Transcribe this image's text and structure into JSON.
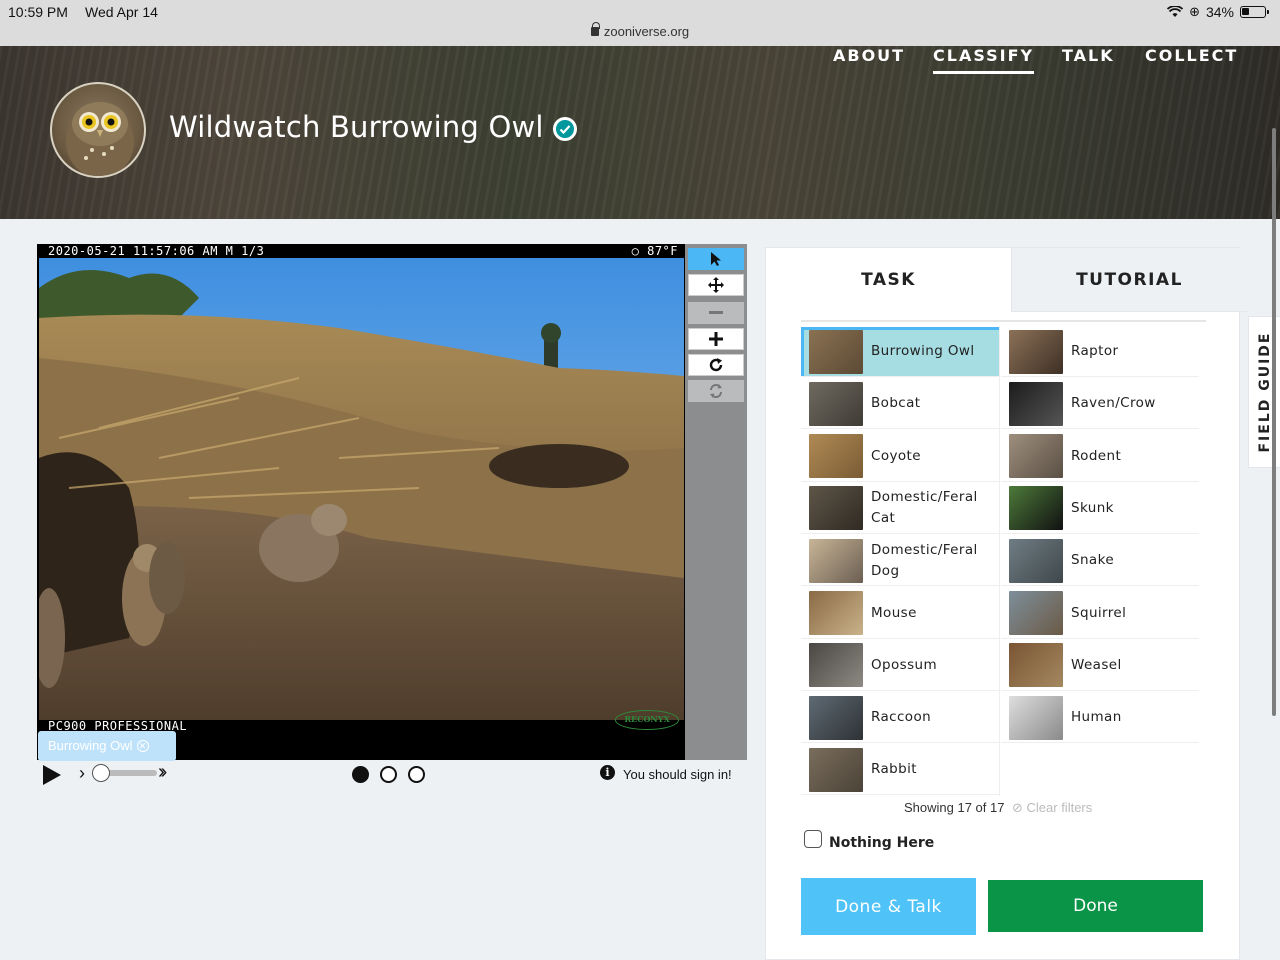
{
  "status_bar": {
    "time": "10:59 PM",
    "date": "Wed Apr 14",
    "url": "zooniverse.org",
    "battery": "34%",
    "battery_fraction": 0.34
  },
  "header": {
    "project_title": "Wildwatch Burrowing Owl",
    "nav": [
      {
        "label": "ABOUT",
        "active": false
      },
      {
        "label": "CLASSIFY",
        "active": true
      },
      {
        "label": "TALK",
        "active": false
      },
      {
        "label": "COLLECT",
        "active": false
      }
    ]
  },
  "viewer": {
    "overlay_top_left": "2020-05-21 11:57:06 AM  M 1/3",
    "overlay_top_right": "○  87°F",
    "overlay_bottom": "PC900 PROFESSIONAL",
    "camera_brand": "RECONYX",
    "annotation_tag": "Burrowing Owl",
    "tools": [
      {
        "name": "pointer-icon",
        "state": "active"
      },
      {
        "name": "move-icon",
        "state": "normal"
      },
      {
        "name": "zoom-out-icon",
        "state": "disabled"
      },
      {
        "name": "zoom-in-icon",
        "state": "normal"
      },
      {
        "name": "rotate-icon",
        "state": "normal"
      },
      {
        "name": "reset-icon",
        "state": "disabled"
      }
    ],
    "frames": [
      true,
      false,
      false
    ],
    "sign_in_message": "You should sign in!"
  },
  "task_panel": {
    "tabs": {
      "task": "TASK",
      "tutorial": "TUTORIAL"
    },
    "choices_left": [
      {
        "label": "Burrowing Owl",
        "selected": true,
        "colors": [
          "#8a7152",
          "#5c4a35"
        ]
      },
      {
        "label": "Bobcat",
        "selected": false,
        "colors": [
          "#6f6a60",
          "#3f3b35"
        ]
      },
      {
        "label": "Coyote",
        "selected": false,
        "colors": [
          "#b08a55",
          "#7a5c34"
        ]
      },
      {
        "label": "Domestic/Feral Cat",
        "selected": false,
        "colors": [
          "#5f5648",
          "#2f2a23"
        ]
      },
      {
        "label": "Domestic/Feral Dog",
        "selected": false,
        "colors": [
          "#c8b597",
          "#6b5f52"
        ]
      },
      {
        "label": "Mouse",
        "selected": false,
        "colors": [
          "#8a6a45",
          "#c9b28a"
        ]
      },
      {
        "label": "Opossum",
        "selected": false,
        "colors": [
          "#4a4742",
          "#8d8a84"
        ]
      },
      {
        "label": "Raccoon",
        "selected": false,
        "colors": [
          "#5f6a73",
          "#2e3236"
        ]
      },
      {
        "label": "Rabbit",
        "selected": false,
        "colors": [
          "#7a6d5c",
          "#4b4338"
        ]
      }
    ],
    "choices_right": [
      {
        "label": "Raptor",
        "selected": false,
        "colors": [
          "#8c7158",
          "#3e3025"
        ]
      },
      {
        "label": "Raven/Crow",
        "selected": false,
        "colors": [
          "#1c1c1c",
          "#555555"
        ]
      },
      {
        "label": "Rodent",
        "selected": false,
        "colors": [
          "#9e8f7e",
          "#5a4f44"
        ]
      },
      {
        "label": "Skunk",
        "selected": false,
        "colors": [
          "#4d7a3a",
          "#111111"
        ]
      },
      {
        "label": "Snake",
        "selected": false,
        "colors": [
          "#6f7d84",
          "#3f474b"
        ]
      },
      {
        "label": "Squirrel",
        "selected": false,
        "colors": [
          "#7d8f9a",
          "#6b5a46"
        ]
      },
      {
        "label": "Weasel",
        "selected": false,
        "colors": [
          "#7a5534",
          "#a48860"
        ]
      },
      {
        "label": "Human",
        "selected": false,
        "colors": [
          "#dedede",
          "#8a8a8a"
        ]
      }
    ],
    "showing_text": "Showing 17 of 17",
    "clear_filters": "Clear filters",
    "nothing_here": "Nothing Here",
    "done_talk_label": "Done & Talk",
    "done_label": "Done"
  },
  "field_guide_label": "FIELD GUIDE",
  "colors": {
    "accent_blue": "#4fc3f7",
    "done_green": "#0a9447",
    "selected_choice": "#a6dde3"
  }
}
